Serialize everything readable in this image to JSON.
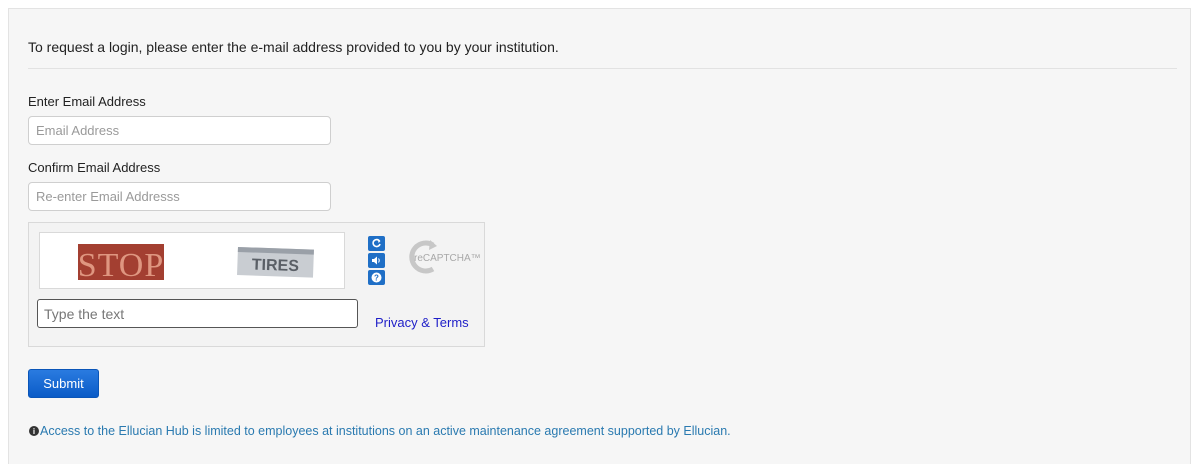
{
  "intro_text": "To request a login, please enter the e-mail address provided to you by your institution.",
  "email": {
    "label": "Enter Email Address",
    "placeholder": "Email Address",
    "value": ""
  },
  "confirm_email": {
    "label": "Confirm Email Address",
    "placeholder": "Re-enter Email Addresss",
    "value": ""
  },
  "captcha": {
    "word1": "STOP",
    "word2": "TIRES",
    "input_placeholder": "Type the text",
    "privacy_label": "Privacy & Terms",
    "logo_text": "reCAPTCHA™",
    "buttons": [
      "refresh-icon",
      "audio-icon",
      "help-icon"
    ]
  },
  "submit_label": "Submit",
  "notice_text": "Access to the Ellucian Hub is limited to employees at institutions on an active maintenance agreement supported by Ellucian.",
  "colors": {
    "accent": "#1f6fc6",
    "notice": "#2a7ab0",
    "link": "#1e1ec8"
  }
}
